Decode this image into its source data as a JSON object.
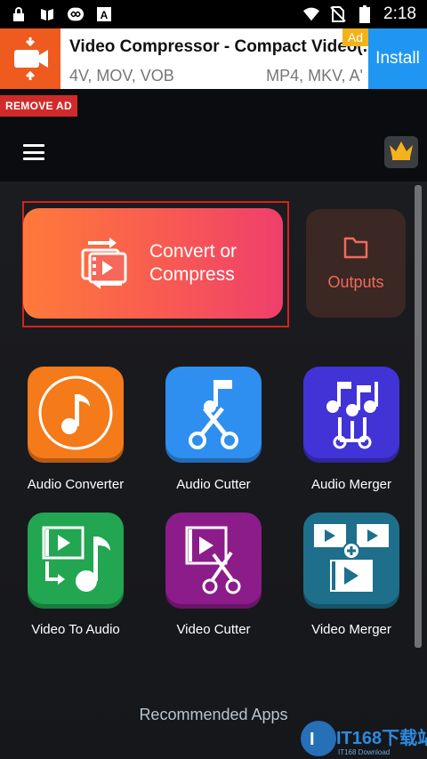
{
  "status_bar": {
    "time": "2:18",
    "icons": [
      "lock-icon",
      "book-icon",
      "infinity-icon",
      "a-icon",
      "wifi-icon",
      "no-sim-icon",
      "battery-icon"
    ]
  },
  "ad": {
    "title": "Video Compressor - Compact Video(...",
    "sub_left": "4V, MOV, VOB",
    "sub_right": "MP4, MKV, A'",
    "badge": "Ad",
    "install": "Install",
    "icon": "video-compress-icon"
  },
  "remove_ad": "REMOVE AD",
  "header": {
    "menu_icon": "hamburger-menu-icon",
    "premium_icon": "crown-icon"
  },
  "primary": {
    "convert_label_line1": "Convert or",
    "convert_label_line2": "Compress",
    "outputs_label": "Outputs"
  },
  "tools": [
    {
      "label": "Audio Converter",
      "icon": "music-note-icon",
      "color": "#f47a1a"
    },
    {
      "label": "Audio Cutter",
      "icon": "scissors-music-icon",
      "color": "#2f8ff0"
    },
    {
      "label": "Audio Merger",
      "icon": "music-notes-merge-icon",
      "color": "#4133d6"
    },
    {
      "label": "Video To Audio",
      "icon": "video-to-audio-icon",
      "color": "#22a651"
    },
    {
      "label": "Video Cutter",
      "icon": "video-scissors-icon",
      "color": "#8b1c8a"
    },
    {
      "label": "Video Merger",
      "icon": "video-merge-icon",
      "color": "#1e6f8b"
    }
  ],
  "recommended": "Recommended Apps",
  "watermark": {
    "brand": "IT168下载站",
    "sub": "IT168 Download"
  },
  "colors": {
    "accent": "#ef3f6c",
    "ad_install": "#2096f3",
    "remove_ad": "#d22a2a"
  }
}
